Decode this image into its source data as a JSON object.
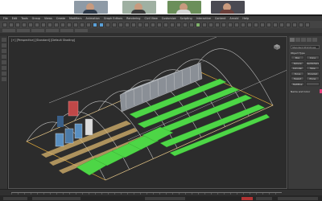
{
  "video_call": {
    "participants": [
      {
        "bg": "#8e9aa6",
        "shirt": "#2e3a4a"
      },
      {
        "bg": "#9fb0a2",
        "shirt": "#3a3a3a"
      },
      {
        "bg": "#6b8f5a",
        "shirt": "#d9d9d9"
      },
      {
        "bg": "#4a4a52",
        "shirt": "#6b3f3a"
      }
    ]
  },
  "menu": {
    "items": [
      "File",
      "Edit",
      "Tools",
      "Group",
      "Views",
      "Create",
      "Modifiers",
      "Animation",
      "Graph Editors",
      "Rendering",
      "Civil View",
      "Customize",
      "Scripting",
      "Interactive",
      "Content",
      "Arnold",
      "Help"
    ]
  },
  "viewport": {
    "label": "[+] [Perspective] [Standard] [Default Shading]"
  },
  "command_panel": {
    "dropdown": "Standard Primitives",
    "section_title": "Object Type",
    "buttons": [
      "Box",
      "Cone",
      "Sphere",
      "GeoSphere",
      "Cylinder",
      "Tube",
      "Torus",
      "Pyramid",
      "Teapot",
      "Plane",
      "TextPlus",
      ""
    ],
    "collapsed_section": "Name and Color"
  },
  "colors": {
    "bench_green": "#4dd646",
    "frame_line": "#d8d8d8",
    "base_outline": "#d9a43a",
    "tank_blue": "#5a8fc0",
    "tank_red": "#c04848"
  }
}
